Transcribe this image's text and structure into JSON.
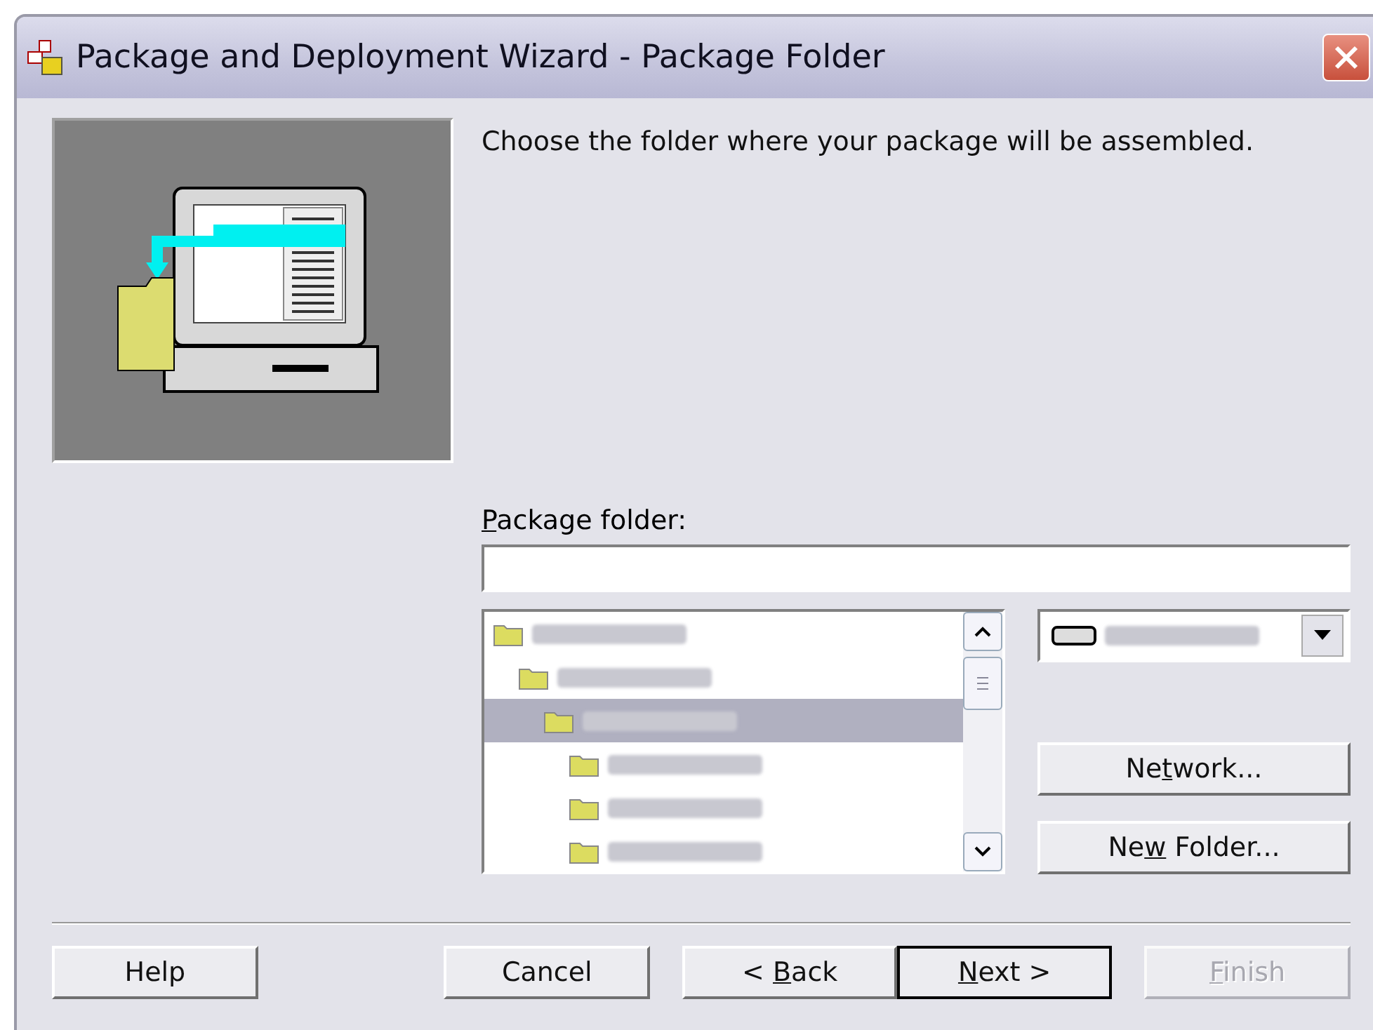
{
  "window": {
    "title": "Package and Deployment Wizard - Package Folder"
  },
  "instructions": "Choose the folder where your package will be assembled.",
  "package_folder": {
    "label": [
      {
        "key": "P",
        "after": "ackage folder:"
      }
    ]
  },
  "folder_list": [
    {
      "selected": false,
      "children": [
        {
          "selected": false,
          "children": [
            {
              "selected": true,
              "children": [
                {
                  "selected": false
                },
                {
                  "selected": false
                },
                {
                  "selected": false
                }
              ]
            }
          ]
        }
      ]
    }
  ],
  "side_buttons": [
    {
      "before": "Ne",
      "key": "t",
      "after": "work..."
    },
    {
      "before": "Ne",
      "key": "w",
      "after": " Folder..."
    }
  ],
  "buttons": [
    {
      "before": "Help",
      "default": false,
      "disabled": false,
      "kind": "left"
    },
    {
      "before": "Cancel",
      "default": false,
      "disabled": false,
      "kind": "right"
    },
    {
      "before": "< ",
      "key": "B",
      "after": "ack",
      "default": false,
      "disabled": false,
      "kind": "right"
    },
    {
      "key": "N",
      "after": "ext >",
      "default": true,
      "disabled": false,
      "kind": "right"
    },
    {
      "key": "F",
      "after": "inish",
      "default": false,
      "disabled": true,
      "kind": "right"
    }
  ]
}
